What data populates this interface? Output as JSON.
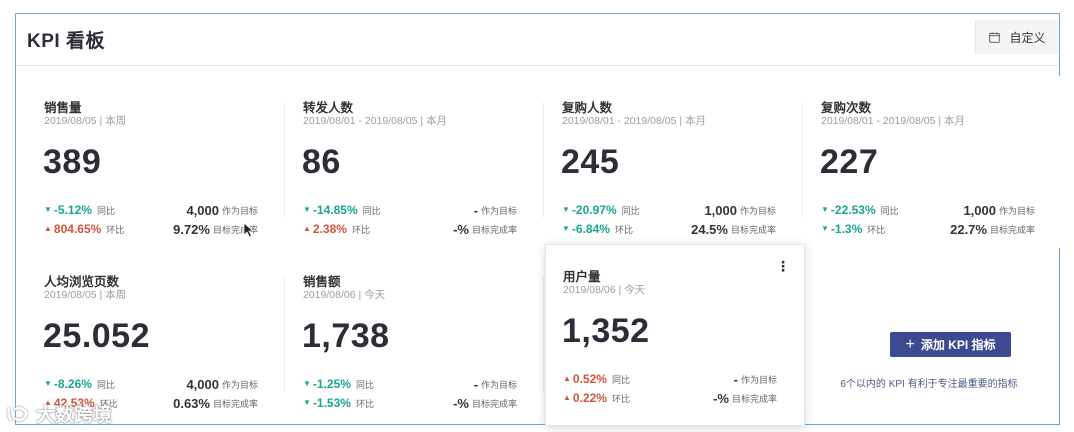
{
  "header": {
    "title": "KPI 看板",
    "custom_label": "自定义"
  },
  "cards": [
    {
      "name": "销售量",
      "date": "2019/08/05 | 本周",
      "value": "389",
      "yoy": {
        "dir": "down",
        "pct": "-5.12%",
        "label": "同比"
      },
      "mom": {
        "dir": "up",
        "pct": "804.65%",
        "label": "环比"
      },
      "target": {
        "num": "4,000",
        "label": "作为目标"
      },
      "rate": {
        "num": "9.72%",
        "label": "目标完成率"
      }
    },
    {
      "name": "转发人数",
      "date": "2019/08/01 - 2019/08/05 | 本月",
      "value": "86",
      "yoy": {
        "dir": "down",
        "pct": "-14.85%",
        "label": "同比"
      },
      "mom": {
        "dir": "up",
        "pct": "2.38%",
        "label": "环比"
      },
      "target": {
        "num": "-",
        "label": "作为目标"
      },
      "rate": {
        "num": "-%",
        "label": "目标完成率"
      }
    },
    {
      "name": "复购人数",
      "date": "2019/08/01 - 2019/08/05 | 本月",
      "value": "245",
      "yoy": {
        "dir": "down",
        "pct": "-20.97%",
        "label": "同比"
      },
      "mom": {
        "dir": "down",
        "pct": "-6.84%",
        "label": "环比"
      },
      "target": {
        "num": "1,000",
        "label": "作为目标"
      },
      "rate": {
        "num": "24.5%",
        "label": "目标完成率"
      }
    },
    {
      "name": "复购次数",
      "date": "2019/08/01 - 2019/08/05 | 本月",
      "value": "227",
      "yoy": {
        "dir": "down",
        "pct": "-22.53%",
        "label": "同比"
      },
      "mom": {
        "dir": "down",
        "pct": "-1.3%",
        "label": "环比"
      },
      "target": {
        "num": "1,000",
        "label": "作为目标"
      },
      "rate": {
        "num": "22.7%",
        "label": "目标完成率"
      }
    },
    {
      "name": "人均浏览页数",
      "date": "2019/08/05 | 本周",
      "value": "25.052",
      "yoy": {
        "dir": "down",
        "pct": "-8.26%",
        "label": "同比"
      },
      "mom": {
        "dir": "up",
        "pct": "42.53%",
        "label": "环比"
      },
      "target": {
        "num": "4,000",
        "label": "作为目标"
      },
      "rate": {
        "num": "0.63%",
        "label": "目标完成率"
      }
    },
    {
      "name": "销售额",
      "date": "2019/08/06 | 今天",
      "value": "1,738",
      "yoy": {
        "dir": "down",
        "pct": "-1.25%",
        "label": "同比"
      },
      "mom": {
        "dir": "down",
        "pct": "-1.53%",
        "label": "环比"
      },
      "target": {
        "num": "-",
        "label": "作为目标"
      },
      "rate": {
        "num": "-%",
        "label": "目标完成率"
      }
    },
    {
      "name": "用户量",
      "date": "2019/08/06 | 今天",
      "value": "1,352",
      "yoy": {
        "dir": "up",
        "pct": "0.52%",
        "label": "同比"
      },
      "mom": {
        "dir": "up",
        "pct": "0.22%",
        "label": "环比"
      },
      "target": {
        "num": "-",
        "label": "作为目标"
      },
      "rate": {
        "num": "-%",
        "label": "目标完成率"
      }
    }
  ],
  "add_kpi": {
    "button_label": "添加 KPI 指标",
    "hint": "6个以内的 KPI 有利于专注最重要的指标"
  },
  "watermark": "大数跨境",
  "colors": {
    "down": "#1aa58f",
    "up": "#d2533c",
    "button": "#3d4a8f",
    "frame_border": "#6aa6d8"
  },
  "icons": {
    "custom": "calendar-icon",
    "kebab": "more-vertical-icon",
    "add": "plus-icon",
    "arrow_down": "triangle-down-icon",
    "arrow_up": "triangle-up-icon"
  }
}
